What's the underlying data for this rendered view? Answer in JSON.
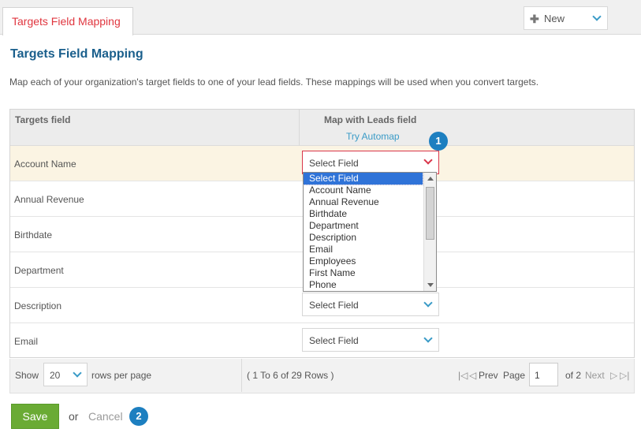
{
  "tab": {
    "title": "Targets Field Mapping"
  },
  "new_button": {
    "label": "New"
  },
  "page": {
    "title": "Targets Field Mapping",
    "description": "Map each of your organization's target fields to one of your lead fields. These mappings will be used when you convert targets."
  },
  "grid": {
    "col1": "Targets field",
    "col2": "Map with Leads field",
    "automap": "Try Automap",
    "rows": [
      {
        "label": "Account Name",
        "select": "Select Field"
      },
      {
        "label": "Annual Revenue",
        "select": "Select Field"
      },
      {
        "label": "Birthdate",
        "select": "Select Field"
      },
      {
        "label": "Department",
        "select": "Select Field"
      },
      {
        "label": "Description",
        "select": "Select Field"
      },
      {
        "label": "Email",
        "select": "Select Field"
      }
    ]
  },
  "dropdown": {
    "options": [
      "Select Field",
      "Account Name",
      "Annual Revenue",
      "Birthdate",
      "Department",
      "Description",
      "Email",
      "Employees",
      "First Name",
      "Phone"
    ]
  },
  "badges": {
    "one": "1",
    "two": "2"
  },
  "footer": {
    "show": "Show",
    "rows_value": "20",
    "rows_per_page": "rows per page",
    "range": "( 1 To 6 of 29 Rows )",
    "prev": "Prev",
    "page": "Page",
    "page_value": "1",
    "of": "of 2",
    "next": "Next"
  },
  "actions": {
    "save": "Save",
    "or": "or",
    "cancel": "Cancel"
  },
  "colors": {
    "accent": "#3a9bc7",
    "tab_title": "#e0363f",
    "title": "#1a5f8c",
    "save": "#6aab34",
    "badge": "#1d7fc0",
    "highlight": "#fbf4e3"
  }
}
